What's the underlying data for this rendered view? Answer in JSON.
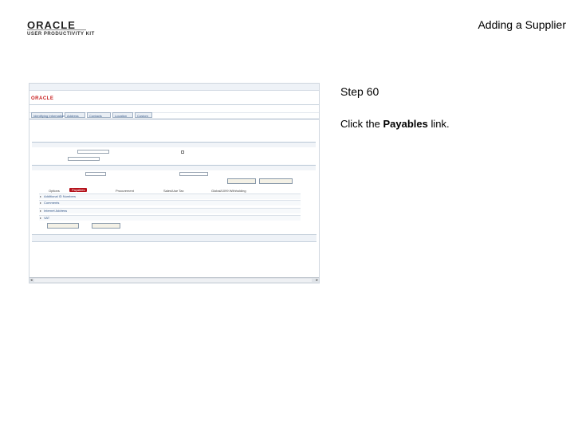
{
  "header": {
    "brand_logo_text": "ORACLE",
    "brand_sub_text": "USER PRODUCTIVITY KIT",
    "slide_title": "Adding a Supplier"
  },
  "instructions": {
    "step": "Step 60",
    "text_before": "Click the ",
    "link_word": "Payables",
    "text_after": " link."
  },
  "colors": {
    "link_blue": "#36598a",
    "oracle_red": "#c81e1e",
    "active_subtab": "#b5121b"
  },
  "screenshot": {
    "brand": "ORACLE",
    "tabs": [
      "Identifying Information",
      "Address",
      "Contacts",
      "Location",
      "Custom"
    ],
    "buttons": {
      "btn1": "",
      "btn2": "",
      "btn3": "",
      "btn4": ""
    },
    "subtabs": [
      "Options",
      "Payables",
      "Procurement",
      "Sales/Use Tax",
      "Global/1099 Withholding"
    ],
    "rows": [
      "Additional ID Numbers",
      "Comments",
      "Internet Address",
      "VAT"
    ]
  }
}
